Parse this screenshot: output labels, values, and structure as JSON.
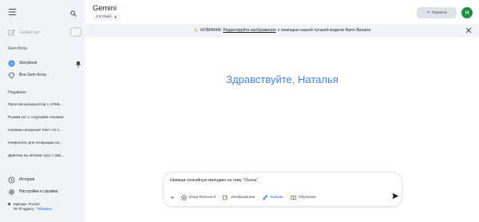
{
  "sidebar": {
    "new_chat_label": "Новый чат",
    "gems_title": "Gem-боты",
    "gems": [
      {
        "label": "Storybook",
        "icon": "storybook-gem-icon"
      },
      {
        "label": "Все Gem-боты",
        "icon": "gems-icon"
      }
    ],
    "recent_title": "Недавнее",
    "recent": [
      "Простой калькулятор с HTML...",
      "Рыжий кот с голубыми глазами",
      "Напиши обзорный текст по с...",
      "Нейросети для генерации из...",
      "Девочка на летнем лугу с баб..."
    ],
    "history_label": "История",
    "settings_label": "Настройки и справка",
    "location_city": "Барнаул, Россия",
    "location_ip": "По IP-адресу",
    "location_update": "Обновить"
  },
  "header": {
    "title": "Gemini",
    "model": "2.5 Flash",
    "upgrade_label": "Перейти",
    "avatar_letter": "Н"
  },
  "banner": {
    "prefix": "НОВИНКА!",
    "link": "Редактируйте изображения",
    "suffix": "с помощью нашей лучшей модели Nano Banana"
  },
  "greeting": "Здравствуйте, Наталья",
  "composer": {
    "prompt": "Напиши спокойную мелодию на тему \"Осень\"",
    "tools": [
      {
        "label": "Deep Research",
        "icon": "deep-research-icon",
        "active": false
      },
      {
        "label": "Изображение",
        "icon": "image-banana-icon",
        "active": false
      },
      {
        "label": "Canvas",
        "icon": "canvas-icon",
        "active": true
      },
      {
        "label": "Обучение",
        "icon": "learning-icon",
        "active": false
      }
    ]
  },
  "colors": {
    "greeting": "#4285f4",
    "sidebar_bg": "#f0f4f9",
    "active_tool": "#0b57d0",
    "avatar": "#1e8e3e"
  }
}
